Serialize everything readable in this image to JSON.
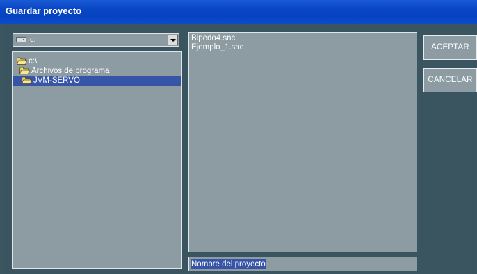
{
  "window": {
    "title": "Guardar proyecto"
  },
  "drive_selector": {
    "value": "c:",
    "icon": "drive-icon"
  },
  "folder_tree": {
    "items": [
      {
        "label": "c:\\",
        "icon": "open-folder-icon"
      },
      {
        "label": "Archivos de programa",
        "icon": "open-folder-icon"
      },
      {
        "label": "JVM-SERVO",
        "icon": "open-folder-icon",
        "selected": true
      }
    ]
  },
  "file_list": {
    "items": [
      {
        "name": "Bipedo4.snc"
      },
      {
        "name": "Ejemplo_1.snc"
      }
    ]
  },
  "project_name_field": {
    "value": "Nombre del proyecto"
  },
  "buttons": {
    "accept": "ACEPTAR",
    "cancel": "CANCELAR"
  },
  "colors": {
    "title_bar": "#0a47c6",
    "panel_bg": "#8d9ba3",
    "window_bg": "#3a5560",
    "selection": "#3655a6",
    "text": "#ffffff"
  }
}
